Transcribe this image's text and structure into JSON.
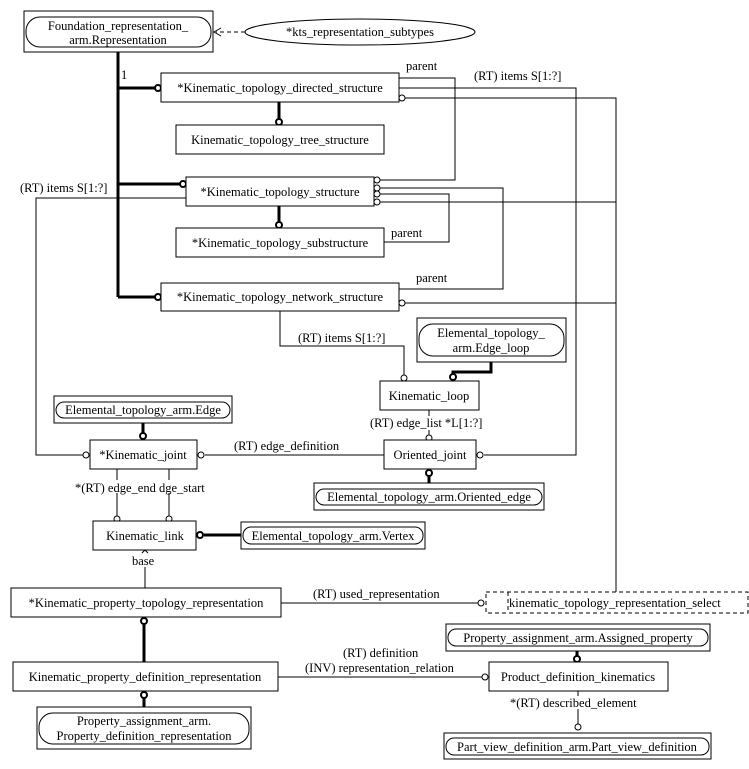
{
  "nodes": {
    "foundation_l1": "Foundation_representation_",
    "foundation_l2": "arm.Representation",
    "kts_subtypes": "*kts_representation_subtypes",
    "directed_structure": "*Kinematic_topology_directed_structure",
    "tree_structure": "Kinematic_topology_tree_structure",
    "topology_structure": "*Kinematic_topology_structure",
    "substructure": "*Kinematic_topology_substructure",
    "network_structure": "*Kinematic_topology_network_structure",
    "edge_loop_l1": "Elemental_topology_",
    "edge_loop_l2": "arm.Edge_loop",
    "kinematic_loop": "Kinematic_loop",
    "edge": "Elemental_topology_arm.Edge",
    "kinematic_joint": "*Kinematic_joint",
    "oriented_joint": "Oriented_joint",
    "oriented_edge": "Elemental_topology_arm.Oriented_edge",
    "kinematic_link": "Kinematic_link",
    "vertex": "Elemental_topology_arm.Vertex",
    "kptr": "*Kinematic_property_topology_representation",
    "select": "kinematic_topology_representation_select",
    "assigned_property": "Property_assignment_arm.Assigned_property",
    "kpdr": "Kinematic_property_definition_representation",
    "pdk": "Product_definition_kinematics",
    "pdr_l1": "Property_assignment_arm.",
    "pdr_l2": "Property_definition_representation",
    "part_view": "Part_view_definition_arm.Part_view_definition"
  },
  "edges": {
    "one": "1",
    "parent1": "parent",
    "parent2": "parent",
    "parent3": "parent",
    "items1": "(RT) items S[1:?]",
    "items2": "(RT) items S[1:?]",
    "items3": "(RT) items S[1:?]",
    "edge_list": "(RT) edge_list *L[1:?]",
    "edge_definition": "(RT) edge_definition",
    "edge_end_start": "*(RT) edge_end dge_start",
    "base": "base",
    "used_representation": "(RT) used_representation",
    "definition": "(RT) definition",
    "representation_relation": "(INV) representation_relation",
    "described_element": "*(RT) described_element"
  }
}
